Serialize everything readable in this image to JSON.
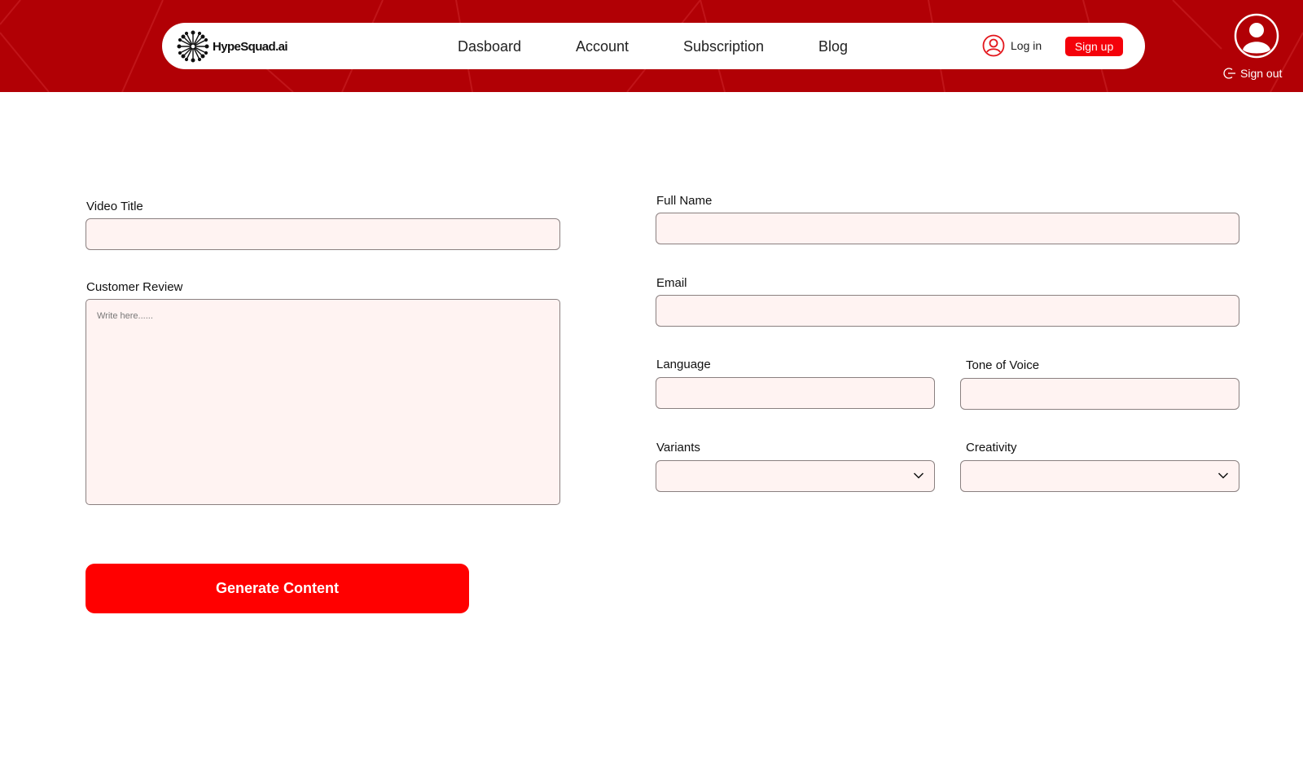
{
  "brand": {
    "name": "HypeSquad.ai",
    "colors": {
      "header_bg": "#b10005",
      "accent": "#f4010a",
      "field_bg": "#fff3f2"
    }
  },
  "nav": {
    "links": [
      {
        "label": "Dasboard"
      },
      {
        "label": "Account"
      },
      {
        "label": "Subscription"
      },
      {
        "label": "Blog"
      }
    ],
    "login_label": "Log in",
    "signup_label": "Sign up"
  },
  "user": {
    "avatar_icon": "user-circle-icon",
    "signout_label": "Sign out"
  },
  "form": {
    "video_title": {
      "label": "Video Title",
      "value": ""
    },
    "customer_review": {
      "label": "Customer Review",
      "value": "",
      "placeholder": "Write here......"
    },
    "full_name": {
      "label": "Full Name",
      "value": ""
    },
    "email": {
      "label": "Email",
      "value": ""
    },
    "language": {
      "label": "Language",
      "value": ""
    },
    "tone_of_voice": {
      "label": "Tone of Voice",
      "value": ""
    },
    "variants": {
      "label": "Variants",
      "selected": ""
    },
    "creativity": {
      "label": "Creativity",
      "selected": ""
    },
    "submit_label": "Generate Content"
  }
}
